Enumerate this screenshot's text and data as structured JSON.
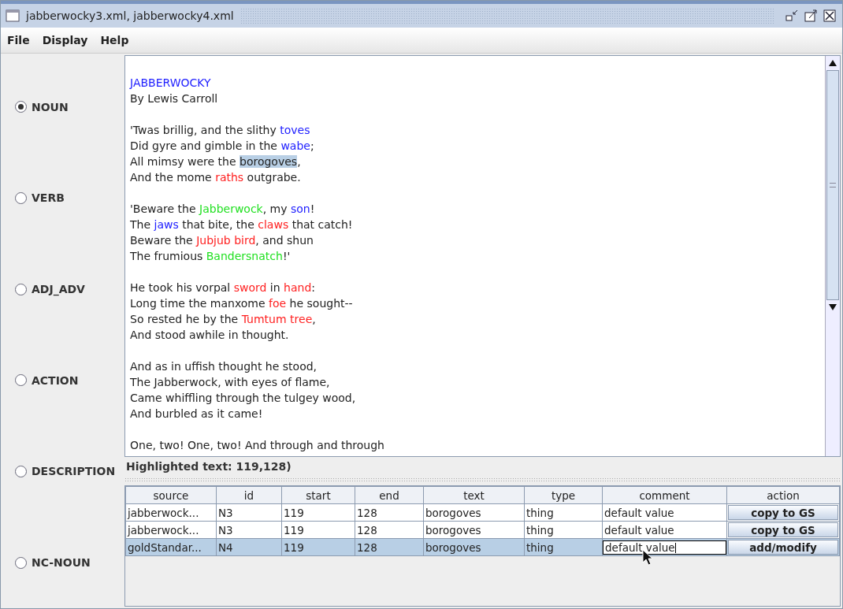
{
  "window": {
    "title": "jabberwocky3.xml, jabberwocky4.xml"
  },
  "menu": [
    "File",
    "Display",
    "Help"
  ],
  "categories": [
    {
      "label": "NOUN",
      "selected": true
    },
    {
      "label": "VERB",
      "selected": false
    },
    {
      "label": "ADJ_ADV",
      "selected": false
    },
    {
      "label": "ACTION",
      "selected": false
    },
    {
      "label": "DESCRIPTION",
      "selected": false
    },
    {
      "label": "NC-NOUN",
      "selected": false
    }
  ],
  "poem": [
    [
      [
        {
          "text": "JABBERWOCKY",
          "color": "#2020ff",
          "selected": false
        }
      ],
      [
        {
          "text": "By Lewis Carroll",
          "selected": false
        }
      ]
    ],
    [
      [
        {
          "text": "'Twas brillig, and the slithy ",
          "selected": false
        },
        {
          "text": "toves",
          "color": "#2020ff",
          "selected": false
        }
      ],
      [
        {
          "text": "Did gyre and gimble in the ",
          "selected": false
        },
        {
          "text": "wabe",
          "color": "#2020ff",
          "selected": false
        },
        {
          "text": ";",
          "selected": false
        }
      ],
      [
        {
          "text": "All mimsy were the ",
          "selected": false
        },
        {
          "text": "borogoves",
          "selected": true
        },
        {
          "text": ",",
          "selected": false
        }
      ],
      [
        {
          "text": "And the mome ",
          "selected": false
        },
        {
          "text": "raths",
          "color": "#ff2020",
          "selected": false
        },
        {
          "text": " outgrabe.",
          "selected": false
        }
      ]
    ],
    [
      [
        {
          "text": "'Beware the ",
          "selected": false
        },
        {
          "text": "Jabberwock",
          "color": "#22e022",
          "selected": false
        },
        {
          "text": ", my ",
          "selected": false
        },
        {
          "text": "son",
          "color": "#2020ff",
          "selected": false
        },
        {
          "text": "!",
          "selected": false
        }
      ],
      [
        {
          "text": "The ",
          "selected": false
        },
        {
          "text": "jaws",
          "color": "#2020ff",
          "selected": false
        },
        {
          "text": " that bite, the ",
          "selected": false
        },
        {
          "text": "claws",
          "color": "#ff2020",
          "selected": false
        },
        {
          "text": " that catch!",
          "selected": false
        }
      ],
      [
        {
          "text": "Beware the ",
          "selected": false
        },
        {
          "text": "Jubjub bird",
          "color": "#ff2020",
          "selected": false
        },
        {
          "text": ", and shun",
          "selected": false
        }
      ],
      [
        {
          "text": "The frumious ",
          "selected": false
        },
        {
          "text": "Bandersnatch",
          "color": "#22e022",
          "selected": false
        },
        {
          "text": "!'",
          "selected": false
        }
      ]
    ],
    [
      [
        {
          "text": "He took his vorpal ",
          "selected": false
        },
        {
          "text": "sword",
          "color": "#ff2020",
          "selected": false
        },
        {
          "text": " in ",
          "selected": false
        },
        {
          "text": "hand",
          "color": "#ff2020",
          "selected": false
        },
        {
          "text": ":",
          "selected": false
        }
      ],
      [
        {
          "text": "Long time the manxome ",
          "selected": false
        },
        {
          "text": "foe",
          "color": "#ff2020",
          "selected": false
        },
        {
          "text": " he sought--",
          "selected": false
        }
      ],
      [
        {
          "text": "So rested he by the ",
          "selected": false
        },
        {
          "text": "Tumtum tree",
          "color": "#ff2020",
          "selected": false
        },
        {
          "text": ",",
          "selected": false
        }
      ],
      [
        {
          "text": "And stood awhile in thought.",
          "selected": false
        }
      ]
    ],
    [
      [
        {
          "text": "And as in uffish thought he stood,",
          "selected": false
        }
      ],
      [
        {
          "text": "The Jabberwock, with eyes of flame,",
          "selected": false
        }
      ],
      [
        {
          "text": "Came whiffling through the tulgey wood,",
          "selected": false
        }
      ],
      [
        {
          "text": "And burbled as it came!",
          "selected": false
        }
      ]
    ],
    [
      [
        {
          "text": "One, two! One, two! And through and through",
          "selected": false
        }
      ]
    ]
  ],
  "status": "Highlighted text: 119,128)",
  "table": {
    "columns": [
      "source",
      "id",
      "start",
      "end",
      "text",
      "type",
      "comment",
      "action"
    ],
    "rows": [
      {
        "cells": [
          "jabberwock...",
          "N3",
          "119",
          "128",
          "borogoves",
          "thing",
          "default value"
        ],
        "action": "copy to GS",
        "selected": false,
        "editing": false
      },
      {
        "cells": [
          "jabberwock...",
          "N3",
          "119",
          "128",
          "borogoves",
          "thing",
          "default value"
        ],
        "action": "copy to GS",
        "selected": false,
        "editing": false
      },
      {
        "cells": [
          "goldStandar...",
          "N4",
          "119",
          "128",
          "borogoves",
          "thing",
          "default value"
        ],
        "action": "add/modify",
        "selected": true,
        "editing": true
      }
    ]
  }
}
